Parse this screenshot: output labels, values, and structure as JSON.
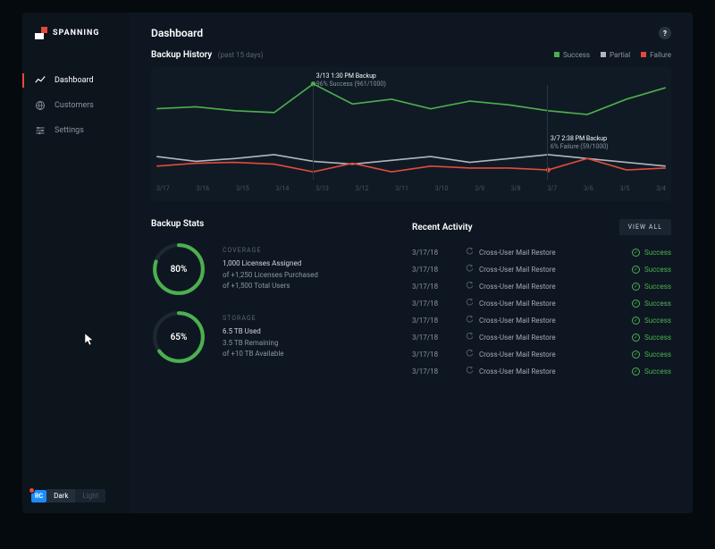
{
  "brand": "SPANNING",
  "header": {
    "title": "Dashboard"
  },
  "sidebar": {
    "items": [
      {
        "label": "Dashboard",
        "icon": "trend-icon",
        "active": true
      },
      {
        "label": "Customers",
        "icon": "globe-icon",
        "active": false
      },
      {
        "label": "Settings",
        "icon": "sliders-icon",
        "active": false
      }
    ]
  },
  "theme": {
    "badge": "RC",
    "options": [
      "Dark",
      "Light"
    ],
    "active": "Dark"
  },
  "chart_data": {
    "type": "line",
    "title": "Backup History",
    "subtitle": "(past 15 days)",
    "categories": [
      "3/17",
      "3/16",
      "3/15",
      "3/14",
      "3/13",
      "3/12",
      "3/11",
      "3/10",
      "3/9",
      "3/8",
      "3/7",
      "3/6",
      "3/5",
      "3/4"
    ],
    "ylim": [
      0,
      100
    ],
    "series": [
      {
        "name": "Success",
        "color": "#4caf50",
        "values": [
          70,
          72,
          68,
          66,
          96,
          75,
          80,
          70,
          78,
          74,
          68,
          64,
          80,
          92
        ]
      },
      {
        "name": "Partial",
        "color": "#b0b6bc",
        "values": [
          20,
          15,
          18,
          22,
          15,
          12,
          16,
          20,
          14,
          18,
          22,
          18,
          14,
          10
        ]
      },
      {
        "name": "Failure",
        "color": "#e24b3b",
        "values": [
          10,
          13,
          14,
          12,
          4,
          13,
          4,
          10,
          8,
          8,
          6,
          18,
          6,
          8
        ]
      }
    ],
    "legend": [
      {
        "label": "Success",
        "color": "#4caf50"
      },
      {
        "label": "Partial",
        "color": "#b0b6bc"
      },
      {
        "label": "Failure",
        "color": "#e24b3b"
      }
    ],
    "tooltips": [
      {
        "x_index": 4,
        "title": "3/13 1:30 PM Backup",
        "sub": "96% Success (961/1000)"
      },
      {
        "x_index": 10,
        "title": "3/7 2:38 PM Backup",
        "sub": "6% Failure (59/1000)"
      }
    ]
  },
  "stats": {
    "title": "Backup Stats",
    "coverage": {
      "label": "COVERAGE",
      "percent": 80,
      "line1": "1,000 Licenses Assigned",
      "line2": "of +1,250 Licenses Purchased",
      "line3": "of +1,500 Total Users",
      "color": "#4caf50"
    },
    "storage": {
      "label": "STORAGE",
      "percent": 65,
      "line1": "6.5 TB Used",
      "line2": "3.5 TB Remaining",
      "line3": "of +10 TB Available",
      "color": "#4caf50"
    }
  },
  "activity": {
    "title": "Recent Activity",
    "view_all": "VIEW ALL",
    "rows": [
      {
        "date": "3/17/18",
        "desc": "Cross-User Mail Restore",
        "status": "Success"
      },
      {
        "date": "3/17/18",
        "desc": "Cross-User Mail Restore",
        "status": "Success"
      },
      {
        "date": "3/17/18",
        "desc": "Cross-User Mail Restore",
        "status": "Success"
      },
      {
        "date": "3/17/18",
        "desc": "Cross-User Mail Restore",
        "status": "Success"
      },
      {
        "date": "3/17/18",
        "desc": "Cross-User Mail Restore",
        "status": "Success"
      },
      {
        "date": "3/17/18",
        "desc": "Cross-User Mail Restore",
        "status": "Success"
      },
      {
        "date": "3/17/18",
        "desc": "Cross-User Mail Restore",
        "status": "Success"
      },
      {
        "date": "3/17/18",
        "desc": "Cross-User Mail Restore",
        "status": "Success"
      }
    ]
  }
}
